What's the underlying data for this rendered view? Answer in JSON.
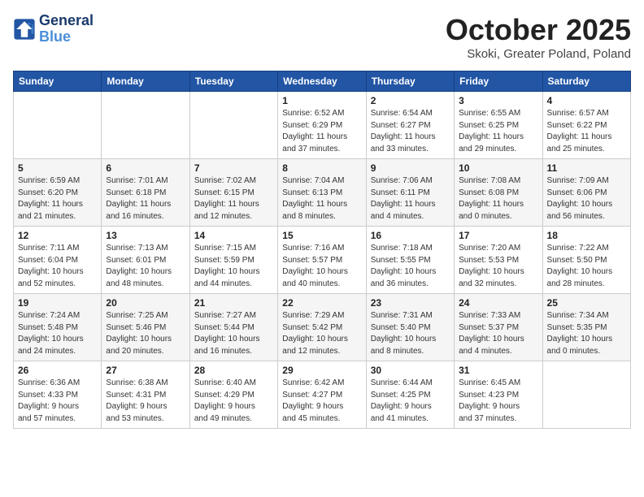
{
  "header": {
    "logo_line1": "General",
    "logo_line2": "Blue",
    "month": "October 2025",
    "location": "Skoki, Greater Poland, Poland"
  },
  "days_of_week": [
    "Sunday",
    "Monday",
    "Tuesday",
    "Wednesday",
    "Thursday",
    "Friday",
    "Saturday"
  ],
  "weeks": [
    [
      {
        "day": "",
        "info": ""
      },
      {
        "day": "",
        "info": ""
      },
      {
        "day": "",
        "info": ""
      },
      {
        "day": "1",
        "info": "Sunrise: 6:52 AM\nSunset: 6:29 PM\nDaylight: 11 hours\nand 37 minutes."
      },
      {
        "day": "2",
        "info": "Sunrise: 6:54 AM\nSunset: 6:27 PM\nDaylight: 11 hours\nand 33 minutes."
      },
      {
        "day": "3",
        "info": "Sunrise: 6:55 AM\nSunset: 6:25 PM\nDaylight: 11 hours\nand 29 minutes."
      },
      {
        "day": "4",
        "info": "Sunrise: 6:57 AM\nSunset: 6:22 PM\nDaylight: 11 hours\nand 25 minutes."
      }
    ],
    [
      {
        "day": "5",
        "info": "Sunrise: 6:59 AM\nSunset: 6:20 PM\nDaylight: 11 hours\nand 21 minutes."
      },
      {
        "day": "6",
        "info": "Sunrise: 7:01 AM\nSunset: 6:18 PM\nDaylight: 11 hours\nand 16 minutes."
      },
      {
        "day": "7",
        "info": "Sunrise: 7:02 AM\nSunset: 6:15 PM\nDaylight: 11 hours\nand 12 minutes."
      },
      {
        "day": "8",
        "info": "Sunrise: 7:04 AM\nSunset: 6:13 PM\nDaylight: 11 hours\nand 8 minutes."
      },
      {
        "day": "9",
        "info": "Sunrise: 7:06 AM\nSunset: 6:11 PM\nDaylight: 11 hours\nand 4 minutes."
      },
      {
        "day": "10",
        "info": "Sunrise: 7:08 AM\nSunset: 6:08 PM\nDaylight: 11 hours\nand 0 minutes."
      },
      {
        "day": "11",
        "info": "Sunrise: 7:09 AM\nSunset: 6:06 PM\nDaylight: 10 hours\nand 56 minutes."
      }
    ],
    [
      {
        "day": "12",
        "info": "Sunrise: 7:11 AM\nSunset: 6:04 PM\nDaylight: 10 hours\nand 52 minutes."
      },
      {
        "day": "13",
        "info": "Sunrise: 7:13 AM\nSunset: 6:01 PM\nDaylight: 10 hours\nand 48 minutes."
      },
      {
        "day": "14",
        "info": "Sunrise: 7:15 AM\nSunset: 5:59 PM\nDaylight: 10 hours\nand 44 minutes."
      },
      {
        "day": "15",
        "info": "Sunrise: 7:16 AM\nSunset: 5:57 PM\nDaylight: 10 hours\nand 40 minutes."
      },
      {
        "day": "16",
        "info": "Sunrise: 7:18 AM\nSunset: 5:55 PM\nDaylight: 10 hours\nand 36 minutes."
      },
      {
        "day": "17",
        "info": "Sunrise: 7:20 AM\nSunset: 5:53 PM\nDaylight: 10 hours\nand 32 minutes."
      },
      {
        "day": "18",
        "info": "Sunrise: 7:22 AM\nSunset: 5:50 PM\nDaylight: 10 hours\nand 28 minutes."
      }
    ],
    [
      {
        "day": "19",
        "info": "Sunrise: 7:24 AM\nSunset: 5:48 PM\nDaylight: 10 hours\nand 24 minutes."
      },
      {
        "day": "20",
        "info": "Sunrise: 7:25 AM\nSunset: 5:46 PM\nDaylight: 10 hours\nand 20 minutes."
      },
      {
        "day": "21",
        "info": "Sunrise: 7:27 AM\nSunset: 5:44 PM\nDaylight: 10 hours\nand 16 minutes."
      },
      {
        "day": "22",
        "info": "Sunrise: 7:29 AM\nSunset: 5:42 PM\nDaylight: 10 hours\nand 12 minutes."
      },
      {
        "day": "23",
        "info": "Sunrise: 7:31 AM\nSunset: 5:40 PM\nDaylight: 10 hours\nand 8 minutes."
      },
      {
        "day": "24",
        "info": "Sunrise: 7:33 AM\nSunset: 5:37 PM\nDaylight: 10 hours\nand 4 minutes."
      },
      {
        "day": "25",
        "info": "Sunrise: 7:34 AM\nSunset: 5:35 PM\nDaylight: 10 hours\nand 0 minutes."
      }
    ],
    [
      {
        "day": "26",
        "info": "Sunrise: 6:36 AM\nSunset: 4:33 PM\nDaylight: 9 hours\nand 57 minutes."
      },
      {
        "day": "27",
        "info": "Sunrise: 6:38 AM\nSunset: 4:31 PM\nDaylight: 9 hours\nand 53 minutes."
      },
      {
        "day": "28",
        "info": "Sunrise: 6:40 AM\nSunset: 4:29 PM\nDaylight: 9 hours\nand 49 minutes."
      },
      {
        "day": "29",
        "info": "Sunrise: 6:42 AM\nSunset: 4:27 PM\nDaylight: 9 hours\nand 45 minutes."
      },
      {
        "day": "30",
        "info": "Sunrise: 6:44 AM\nSunset: 4:25 PM\nDaylight: 9 hours\nand 41 minutes."
      },
      {
        "day": "31",
        "info": "Sunrise: 6:45 AM\nSunset: 4:23 PM\nDaylight: 9 hours\nand 37 minutes."
      },
      {
        "day": "",
        "info": ""
      }
    ]
  ]
}
